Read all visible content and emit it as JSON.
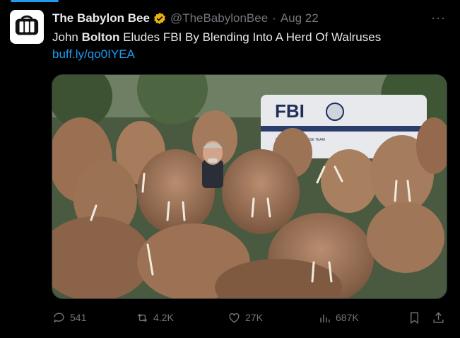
{
  "tweet": {
    "author_name": "The Babylon Bee",
    "author_handle": "@TheBabylonBee",
    "separator": "·",
    "date": "Aug 22",
    "more_icon": "more-dots-icon",
    "verified_icon": "verified-badge-icon",
    "text_pre": "John ",
    "text_bold": "Bolton",
    "text_post": " Eludes FBI By Blending Into A Herd Of Walruses",
    "link": "buff.ly/qo0IYEA",
    "image": {
      "alt": "Photo of a herd of walruses with a man among them and an FBI van in background",
      "van_label": "FBI",
      "van_sublabel": "EVIDENCE RESPONSE TEAM"
    }
  },
  "actions": {
    "replies": "541",
    "reposts": "4.2K",
    "likes": "27K",
    "views": "687K"
  },
  "colors": {
    "accent": "#1d9bf0",
    "muted": "#71767b",
    "badge": "#e8b20b"
  }
}
